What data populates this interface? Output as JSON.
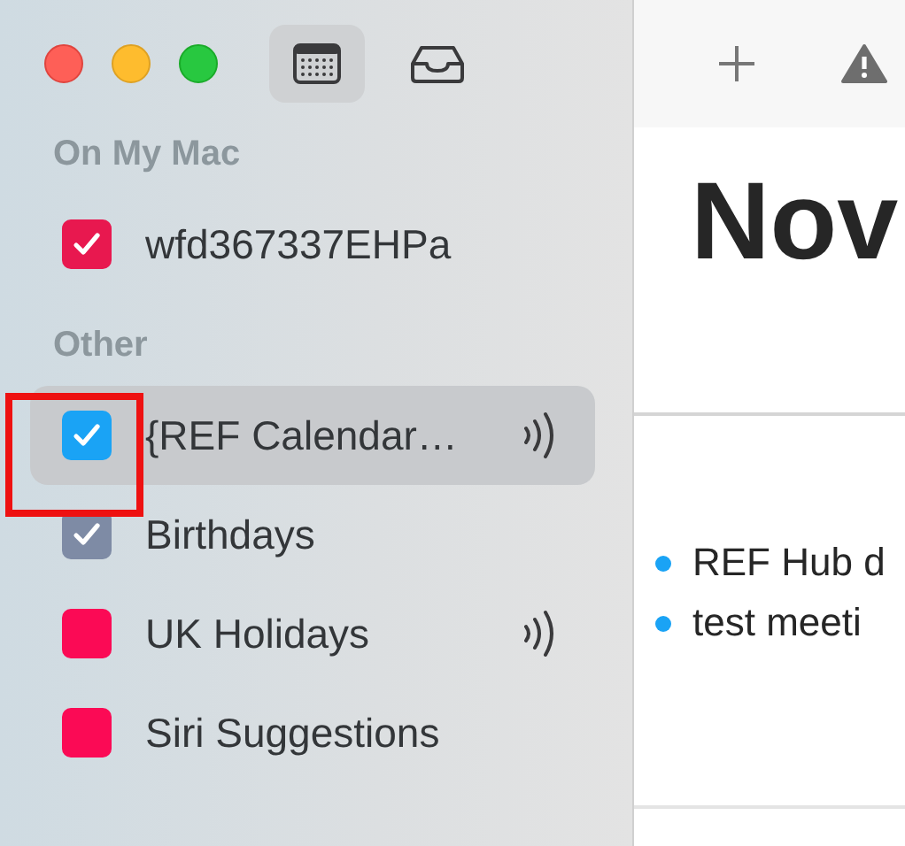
{
  "toolbar": {
    "calendar_view_selected": true
  },
  "sidebar": {
    "groups": [
      {
        "title": "On My Mac",
        "calendars": [
          {
            "name": "wfd367337EHPa",
            "checked": true,
            "color": "#e8184f",
            "selected": false,
            "shared": false
          }
        ]
      },
      {
        "title": "Other",
        "calendars": [
          {
            "name": "{REF Calendar…",
            "checked": true,
            "color": "#1aa3f5",
            "selected": true,
            "shared": true
          },
          {
            "name": "Birthdays",
            "checked": true,
            "color": "#7e8ba5",
            "selected": false,
            "shared": false
          },
          {
            "name": "UK Holidays",
            "checked": false,
            "color": "#fb0a55",
            "selected": false,
            "shared": true
          },
          {
            "name": "Siri Suggestions",
            "checked": false,
            "color": "#fb0a55",
            "selected": false,
            "shared": false
          }
        ]
      }
    ]
  },
  "main": {
    "title": "Nov",
    "events": [
      {
        "title": "REF Hub d",
        "color": "#1aa3f5"
      },
      {
        "title": "test meeti",
        "color": "#1aa3f5"
      }
    ]
  }
}
